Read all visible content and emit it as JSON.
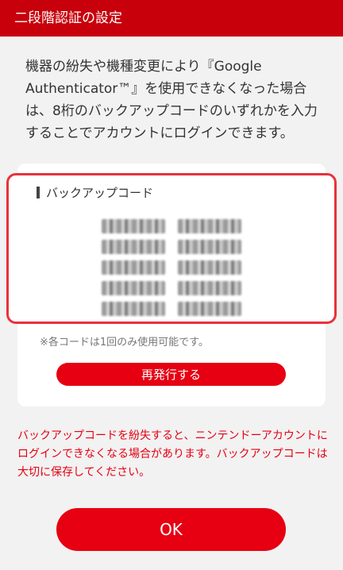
{
  "header": {
    "title": "二段階認証の設定"
  },
  "intro": {
    "text": "機器の紛失や機種変更により『Google Authenticator™』を使用できなくなった場合は、8桁のバックアップコードのいずれかを入力することでアカウントにログインできます。"
  },
  "backup": {
    "title": "バックアップコード",
    "code_count": 10,
    "note": "※各コードは1回のみ使用可能です。",
    "reissue_label": "再発行する"
  },
  "warning": {
    "text": "バックアップコードを紛失すると、ニンテンドーアカウントにログインできなくなる場合があります。バックアップコードは大切に保存してください。"
  },
  "ok_label": "OK",
  "colors": {
    "accent": "#e60012",
    "header": "#c7000b",
    "highlight_border": "#e8323c"
  }
}
